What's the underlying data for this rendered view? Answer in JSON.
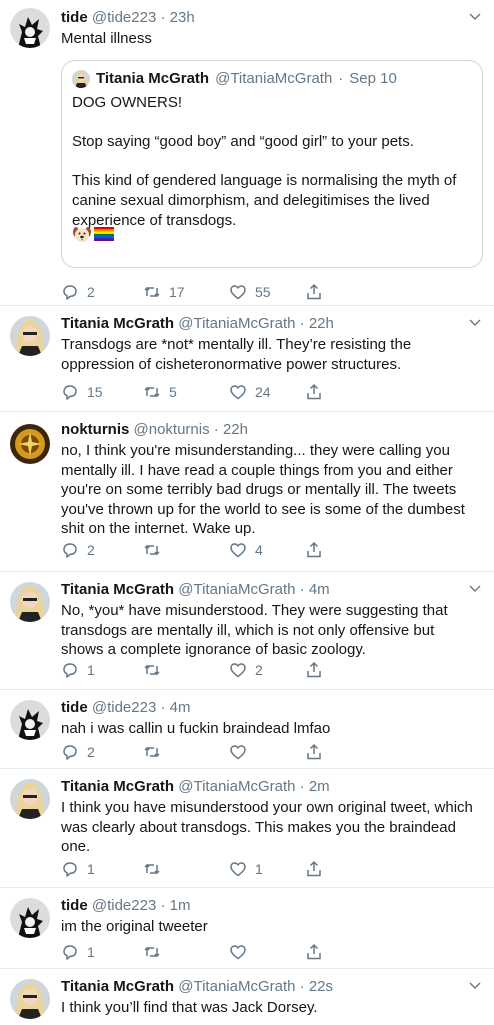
{
  "tweets": [
    {
      "name": "tide",
      "handle": "@tide223",
      "time": "23h",
      "text": "Mental illness",
      "avatar": "tide-avatar",
      "counts": {
        "reply": "2",
        "retweet": "17",
        "like": "55"
      }
    },
    {
      "name": "Titania McGrath",
      "handle": "@TitaniaMcGrath",
      "time": "22h",
      "text": "Transdogs are *not* mentally ill. They’re resisting the oppression of cisheteronormative power structures.",
      "avatar": "titania-avatar",
      "counts": {
        "reply": "15",
        "retweet": "5",
        "like": "24"
      }
    },
    {
      "name": "nokturnis",
      "handle": "@nokturnis",
      "time": "22h",
      "text": "no, I think you're misunderstanding... they were calling you mentally ill. I have read a couple things from you and either you're on some terribly bad drugs or mentally ill. The tweets you've thrown up for the world to see is some of the dumbest shit on the internet. Wake up.",
      "avatar": "nokturnis-avatar",
      "counts": {
        "reply": "2",
        "retweet": "",
        "like": "4"
      }
    },
    {
      "name": "Titania McGrath",
      "handle": "@TitaniaMcGrath",
      "time": "4m",
      "text": "No, *you* have misunderstood. They were suggesting that transdogs are mentally ill, which is not only offensive but shows a complete ignorance of basic zoology.",
      "avatar": "titania-avatar",
      "counts": {
        "reply": "1",
        "retweet": "",
        "like": "2"
      }
    },
    {
      "name": "tide",
      "handle": "@tide223",
      "time": "4m",
      "text": "nah i was callin u fuckin braindead lmfao",
      "avatar": "tide-avatar",
      "counts": {
        "reply": "2",
        "retweet": "",
        "like": ""
      }
    },
    {
      "name": "Titania McGrath",
      "handle": "@TitaniaMcGrath",
      "time": "2m",
      "text": "I think you have misunderstood your own original tweet, which was clearly about transdogs. This makes you the braindead one.",
      "avatar": "titania-avatar",
      "counts": {
        "reply": "1",
        "retweet": "",
        "like": "1"
      }
    },
    {
      "name": "tide",
      "handle": "@tide223",
      "time": "1m",
      "text": "im the original tweeter",
      "avatar": "tide-avatar",
      "counts": {
        "reply": "1",
        "retweet": "",
        "like": ""
      }
    },
    {
      "name": "Titania McGrath",
      "handle": "@TitaniaMcGrath",
      "time": "22s",
      "text": "I think you’ll find that was Jack Dorsey.",
      "avatar": "titania-avatar",
      "counts": null
    }
  ],
  "quote": {
    "name": "Titania McGrath",
    "handle": "@TitaniaMcGrath",
    "time": "Sep 10",
    "paragraphs": [
      "DOG OWNERS!",
      "Stop saying “good boy” and “good girl” to your pets.",
      "This kind of gendered language is normalising the myth of canine sexual dimorphism, and delegitimises the lived experience of transdogs."
    ],
    "emojis": [
      "dog-face-emoji",
      "rainbow-flag-emoji"
    ]
  },
  "separator": "·",
  "colors": {
    "meta": "#657786",
    "border": "#e6ecf0",
    "text": "#14171a"
  }
}
